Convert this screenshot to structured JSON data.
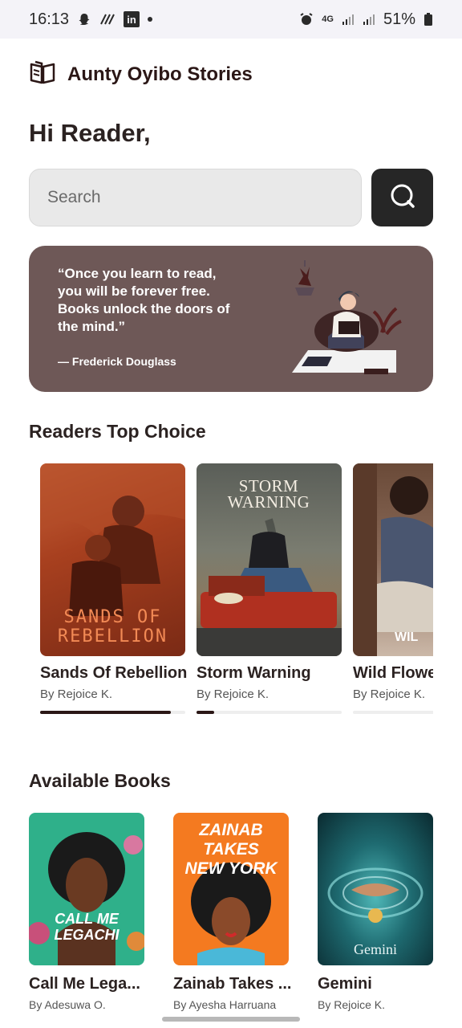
{
  "status_bar": {
    "time": "16:13",
    "linkedin_label": "in",
    "network": "4G",
    "battery": "51%"
  },
  "header": {
    "title": "Aunty Oyibo Stories",
    "logo_icon": "open-book-icon"
  },
  "greeting": "Hi Reader,",
  "search": {
    "placeholder": "Search",
    "button_icon": "search-icon"
  },
  "quote": {
    "text": "“Once you learn to read, you will be forever free. Books unlock the doors of the mind.”",
    "author": "— Frederick Douglass"
  },
  "top_choice": {
    "title": "Readers Top Choice",
    "books": [
      {
        "title": "Sands Of Rebellion",
        "author": "By Rejoice K.",
        "progress": 0.9,
        "cover_text": "SANDS OF REBELLION"
      },
      {
        "title": "Storm Warning",
        "author": "By Rejoice K.",
        "progress": 0.12,
        "cover_text": "STORM WARNING"
      },
      {
        "title": "Wild Flowe",
        "author": "By Rejoice K.",
        "progress": 0.0,
        "cover_text": "WIL"
      }
    ]
  },
  "available": {
    "title": "Available Books",
    "books": [
      {
        "title": "Call Me Lega...",
        "author": "By Adesuwa O.",
        "cover_text": "CALL ME LEGACHI"
      },
      {
        "title": "Zainab Takes ...",
        "author": "By Ayesha Harruana",
        "cover_text": "ZAINAB TAKES NEW YORK"
      },
      {
        "title": "Gemini",
        "author": "By Rejoice K.",
        "cover_text": "Gemini"
      }
    ]
  },
  "colors": {
    "accent_dark": "#2b1716",
    "quote_bg": "#6e5857",
    "search_button": "#262626"
  }
}
